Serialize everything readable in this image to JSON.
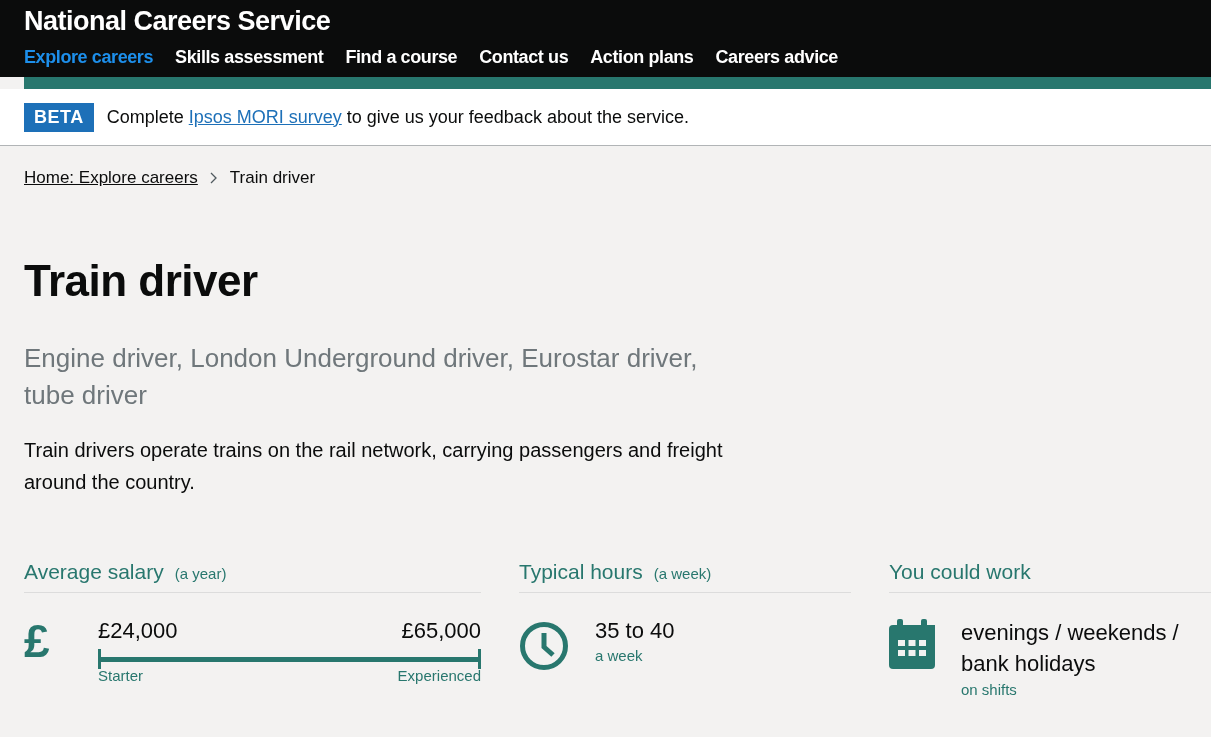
{
  "header": {
    "title": "National Careers Service",
    "nav": [
      {
        "label": "Explore careers",
        "selected": true
      },
      {
        "label": "Skills assessment",
        "selected": false
      },
      {
        "label": "Find a course",
        "selected": false
      },
      {
        "label": "Contact us",
        "selected": false
      },
      {
        "label": "Action plans",
        "selected": false
      },
      {
        "label": "Careers advice",
        "selected": false
      }
    ]
  },
  "banner": {
    "tag": "BETA",
    "before": "Complete",
    "link": "Ipsos MORI survey",
    "after": "to give us your feedback about the service."
  },
  "breadcrumbs": {
    "link": "Home: Explore careers",
    "current": "Train driver"
  },
  "title": "Train driver",
  "alternative_titles": "Engine driver, London Underground driver, Eurostar driver, tube driver",
  "summary": "Train drivers operate trains on the rail network, carrying passengers and freight around the country.",
  "salary": {
    "heading": "Average salary",
    "qualifier": "(a year)",
    "icon": "£",
    "starter": "£24,000",
    "experienced": "£65,000",
    "starter_label": "Starter",
    "experienced_label": "Experienced"
  },
  "hours": {
    "heading": "Typical hours",
    "qualifier": "(a week)",
    "value": "35 to 40",
    "note": "a week"
  },
  "work": {
    "heading": "You could work",
    "value": "evenings / weekends / bank holidays",
    "note": "on shifts"
  }
}
